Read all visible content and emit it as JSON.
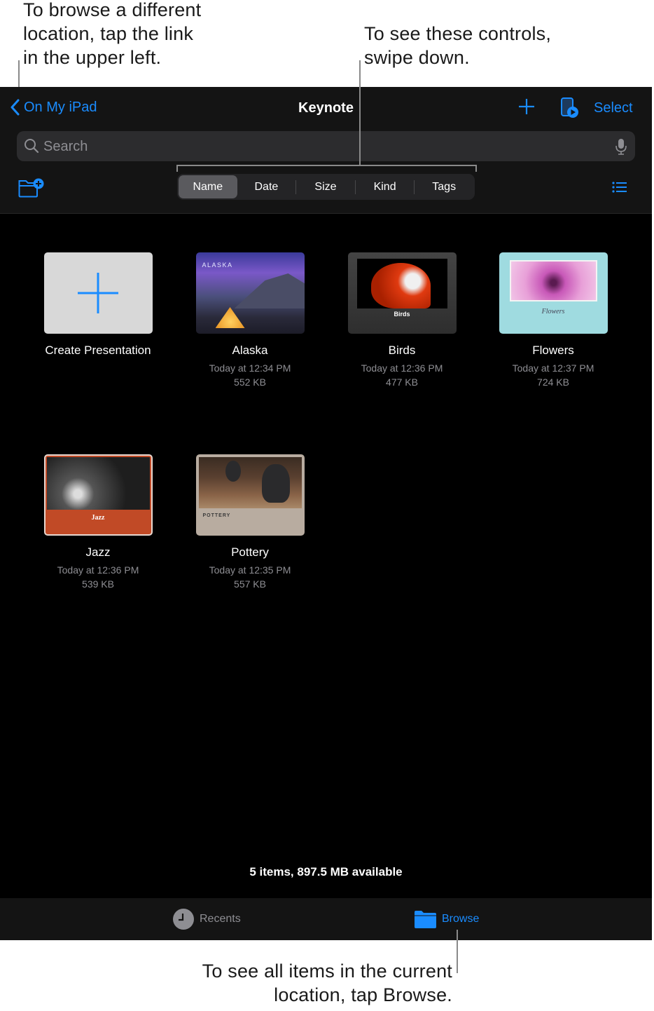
{
  "callouts": {
    "top_left": [
      "To browse a different",
      "location, tap the link",
      "in the upper left."
    ],
    "top_right": [
      "To see these controls,",
      "swipe down."
    ],
    "bottom": [
      "To see all items in the current",
      "location, tap Browse."
    ]
  },
  "navbar": {
    "back_label": "On My iPad",
    "title": "Keynote",
    "select_label": "Select",
    "icons": [
      "chevron-left-icon",
      "plus-icon",
      "remote-play-icon"
    ]
  },
  "search": {
    "placeholder": "Search",
    "value": ""
  },
  "sort": {
    "options": [
      "Name",
      "Date",
      "Size",
      "Kind",
      "Tags"
    ],
    "selected": "Name"
  },
  "files": [
    {
      "name": "Create Presentation",
      "type": "create"
    },
    {
      "name": "Alaska",
      "date": "Today at 12:34 PM",
      "size": "552 KB",
      "thumb_label": "ALASKA"
    },
    {
      "name": "Birds",
      "date": "Today at 12:36 PM",
      "size": "477 KB",
      "thumb_label": "Birds"
    },
    {
      "name": "Flowers",
      "date": "Today at 12:37 PM",
      "size": "724 KB",
      "thumb_label": "Flowers"
    },
    {
      "name": "Jazz",
      "date": "Today at 12:36 PM",
      "size": "539 KB",
      "thumb_label": "Jazz"
    },
    {
      "name": "Pottery",
      "date": "Today at 12:35 PM",
      "size": "557 KB",
      "thumb_label": "POTTERY"
    }
  ],
  "footer": {
    "status": "5 items, 897.5 MB available"
  },
  "tabbar": {
    "tabs": [
      {
        "label": "Recents",
        "icon": "clock-icon",
        "active": false
      },
      {
        "label": "Browse",
        "icon": "folder-icon",
        "active": true
      }
    ]
  },
  "colors": {
    "accent": "#1a8cff",
    "background": "#000000",
    "bar": "#141414"
  }
}
